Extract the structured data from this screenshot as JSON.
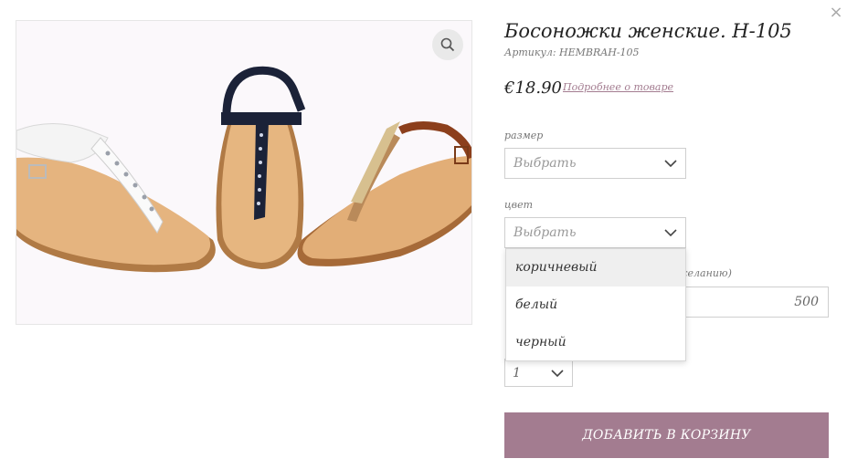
{
  "product": {
    "title": "Босоножки женские. H-105",
    "sku": "Артикул: HEMBRAH-105",
    "price": "€18.90",
    "details_link": "Подробнее о товаре",
    "image_alt": "Женские босоножки"
  },
  "options": {
    "size": {
      "label": "размер",
      "value": "Выбрать"
    },
    "color": {
      "label": "цвет",
      "value": "Выбрать",
      "dropdown": [
        "коричневый",
        "белый",
        "черный"
      ],
      "highlighted_index": 0
    },
    "amount": {
      "label_partial": "желанию)",
      "value": "500"
    },
    "quantity": {
      "value": "1"
    }
  },
  "actions": {
    "add_to_cart": "ДОБАВИТЬ В КОРЗИНУ",
    "close": "×"
  },
  "colors": {
    "accent": "#a37c90",
    "border": "#cfcfcf"
  },
  "icons": {
    "zoom": "search-icon",
    "close": "close-icon",
    "chevron": "chevron-down-icon"
  }
}
